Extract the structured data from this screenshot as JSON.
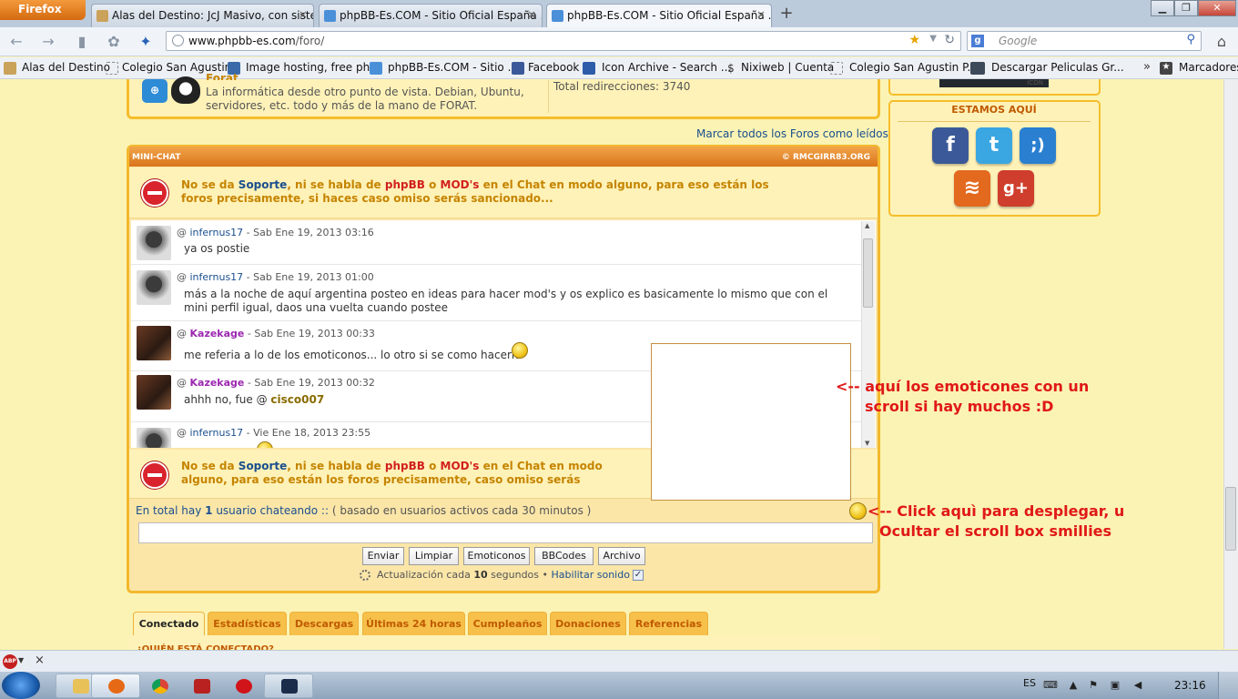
{
  "browser": {
    "firefox_button": "Firefox",
    "tabs": [
      {
        "label": "Alas del Destino: JcJ Masivo, con siste...",
        "close": "×"
      },
      {
        "label": "phpBB-Es.COM - Sitio Oficial España ...",
        "close": "×"
      },
      {
        "label": "phpBB-Es.COM - Sitio Oficial España ...",
        "close": "×"
      }
    ],
    "new_tab": "+",
    "url_host": "www.phpbb-es.com",
    "url_path": "/foro/",
    "search_placeholder": "Google",
    "bookmarks": [
      "Alas del Destino",
      "Colegio San Agustin",
      "Image hosting, free ph...",
      "phpBB-Es.COM - Sitio ...",
      "Facebook",
      "Icon Archive - Search ...",
      "Nixiweb | Cuenta",
      "Colegio San Agustin P...",
      "Descargar Peliculas Gr..."
    ],
    "bookmarks_menu": "Marcadores",
    "bookmarks_more": "»"
  },
  "forat": {
    "title": "Forat",
    "desc": "La informática desde otro punto de vista. Debian, Ubuntu, servidores, etc. todo y más de la mano de FORAT.",
    "stat": "Total redirecciones: 3740"
  },
  "marcar_link": "Marcar todos los Foros como leídos",
  "chat": {
    "title": "MINI-CHAT",
    "credit": "© RMCGIRR83.ORG",
    "notice1": {
      "a": "No se da ",
      "soporte": "Soporte",
      "b": ", ni se habla de ",
      "phpbb": "phpBB",
      "c": " o ",
      "mods": "MOD's",
      "d": " en el Chat en modo alguno, para eso están los foros precisamente, si haces caso omiso serás sancionado..."
    },
    "notice2": {
      "a": "No se da ",
      "soporte": "Soporte",
      "b": ", ni se habla de ",
      "phpbb": "phpBB",
      "c": " o ",
      "mods": "MOD's",
      "d": " en el Chat en modo alguno, para eso están los foros precisamente, caso omiso serás sancionado..."
    },
    "messages": [
      {
        "at": "@",
        "user": "infernus17",
        "date": " - Sab Ene 19, 2013 03:16",
        "text": "ya os postie"
      },
      {
        "at": "@",
        "user": "infernus17",
        "date": " - Sab Ene 19, 2013 01:00",
        "text": "más a la noche de aquí argentina posteo en ideas para hacer mod's y os explico es basicamente lo mismo que con el mini perfil igual, daos una vuelta cuando postee"
      },
      {
        "at": "@",
        "user": "Kazekage",
        "date": " - Sab Ene 19, 2013 00:33",
        "text": "me referia a lo de los emoticonos... lo otro si se como hacerlo"
      },
      {
        "at": "@",
        "user": "Kazekage",
        "date": " - Sab Ene 19, 2013 00:32",
        "text": "ahhh no, fue @ ",
        "mention": "cisco007"
      },
      {
        "at": "@",
        "user": "infernus17",
        "date": " - Vie Ene 18, 2013 23:55",
        "text": ""
      }
    ],
    "online_a": "En total hay ",
    "online_count": "1",
    "online_b": " usuario chateando :: ",
    "online_c": " ( basado en usuarios activos cada 30 minutos )",
    "buttons": [
      "Enviar",
      "Limpiar",
      "Emoticonos",
      "BBCodes",
      "Archivo"
    ],
    "update_a": "Actualización cada ",
    "update_n": "10",
    "update_b": " segundos • ",
    "sound": "Habilitar sonido",
    "sound_checked": "✓"
  },
  "annotations": {
    "emoticons_line1": "<-- aquí los emoticones con un",
    "emoticons_line2": "scroll si hay muchos :D",
    "click_line1": "<-- Click aquì para desplegar, u",
    "click_line2": "Ocultar el scroll box smillies"
  },
  "sidebar": {
    "img_text": "ICON",
    "heading": "ESTAMOS AQUÍ",
    "icons": [
      {
        "name": "facebook",
        "glyph": "f",
        "color": "#3b5998"
      },
      {
        "name": "twitter",
        "glyph": "t",
        "color": "#3aa6e2"
      },
      {
        "name": "wink",
        "glyph": ";)",
        "color": "#2a7fd0"
      },
      {
        "name": "rss",
        "glyph": "≋",
        "color": "#e3691f"
      },
      {
        "name": "google-plus",
        "glyph": "g+",
        "color": "#cf3e2c"
      }
    ]
  },
  "bottom_tabs": [
    "Conectado",
    "Estadísticas",
    "Descargas",
    "Últimas 24 horas",
    "Cumpleaños",
    "Donaciones",
    "Referencias"
  ],
  "quien": "¿QUIÉN ESTÁ CONECTADO?",
  "taskbar": {
    "lang": "ES",
    "clock": "23:16"
  }
}
